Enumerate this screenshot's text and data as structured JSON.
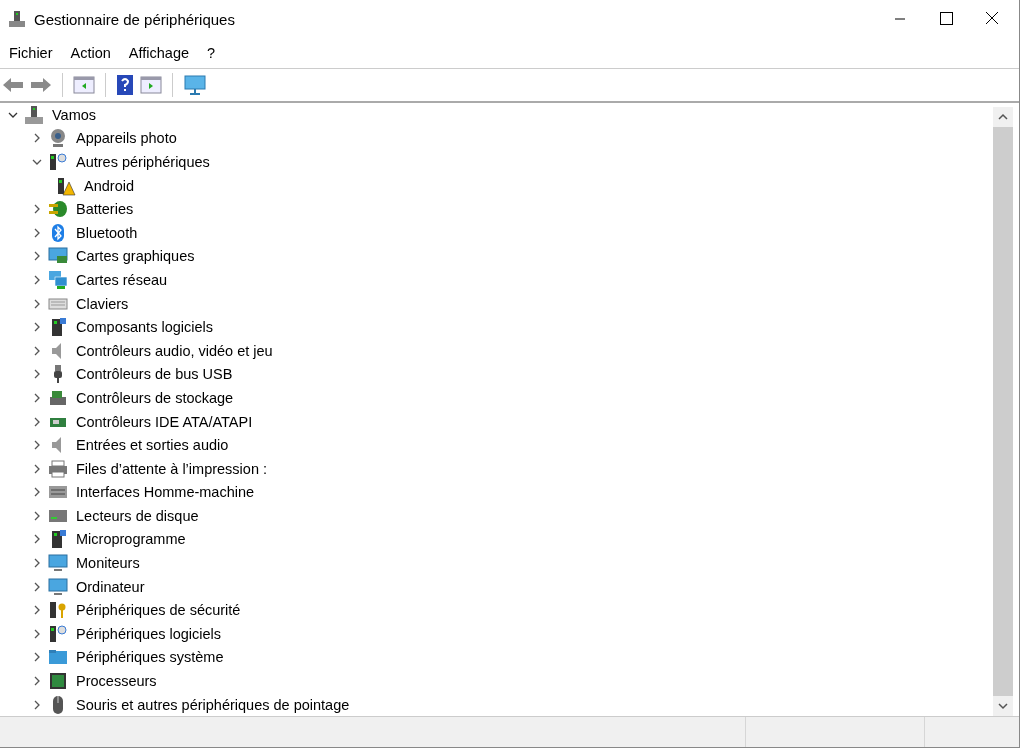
{
  "window": {
    "title": "Gestionnaire de périphériques"
  },
  "menu": [
    "Fichier",
    "Action",
    "Affichage",
    "?"
  ],
  "tree": {
    "label": "Vamos",
    "expanded": true,
    "children": [
      {
        "label": "Appareils photo",
        "kind": "category",
        "expanded": false
      },
      {
        "label": "Autres périphériques",
        "kind": "category",
        "expanded": true,
        "children": [
          {
            "label": "Android",
            "kind": "device"
          }
        ]
      },
      {
        "label": "Batteries",
        "kind": "category",
        "expanded": false
      },
      {
        "label": "Bluetooth",
        "kind": "category",
        "expanded": false
      },
      {
        "label": "Cartes graphiques",
        "kind": "category",
        "expanded": false
      },
      {
        "label": "Cartes réseau",
        "kind": "category",
        "expanded": false
      },
      {
        "label": "Claviers",
        "kind": "category",
        "expanded": false
      },
      {
        "label": "Composants logiciels",
        "kind": "category",
        "expanded": false
      },
      {
        "label": "Contrôleurs audio, vidéo et jeu",
        "kind": "category",
        "expanded": false
      },
      {
        "label": "Contrôleurs de bus USB",
        "kind": "category",
        "expanded": false
      },
      {
        "label": "Contrôleurs de stockage",
        "kind": "category",
        "expanded": false
      },
      {
        "label": "Contrôleurs IDE ATA/ATAPI",
        "kind": "category",
        "expanded": false
      },
      {
        "label": "Entrées et sorties audio",
        "kind": "category",
        "expanded": false
      },
      {
        "label": "Files d’attente à l’impression :",
        "kind": "category",
        "expanded": false
      },
      {
        "label": "Interfaces Homme-machine",
        "kind": "category",
        "expanded": false
      },
      {
        "label": "Lecteurs de disque",
        "kind": "category",
        "expanded": false
      },
      {
        "label": "Microprogramme",
        "kind": "category",
        "expanded": false
      },
      {
        "label": "Moniteurs",
        "kind": "category",
        "expanded": false
      },
      {
        "label": "Ordinateur",
        "kind": "category",
        "expanded": false
      },
      {
        "label": "Périphériques de sécurité",
        "kind": "category",
        "expanded": false
      },
      {
        "label": "Périphériques logiciels",
        "kind": "category",
        "expanded": false
      },
      {
        "label": "Périphériques système",
        "kind": "category",
        "expanded": false
      },
      {
        "label": "Processeurs",
        "kind": "category",
        "expanded": false
      },
      {
        "label": "Souris et autres périphériques de pointage",
        "kind": "category",
        "expanded": false
      }
    ]
  }
}
